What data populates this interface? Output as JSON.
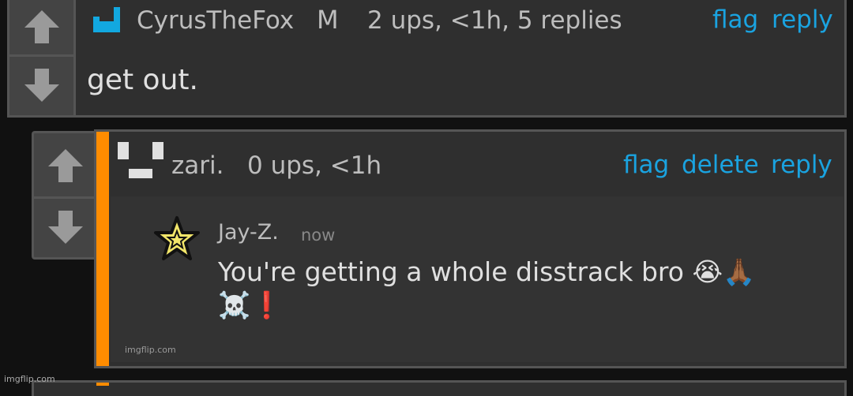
{
  "comment1": {
    "username": "CyrusTheFox",
    "badge": "M",
    "stats": "2 ups, <1h, 5 replies",
    "actions": [
      "flag",
      "reply"
    ],
    "text": "get out.",
    "avatar_color": "#12a8e0"
  },
  "comment2": {
    "username": "zari.",
    "stats": "0 ups, <1h",
    "actions": [
      "flag",
      "delete",
      "reply"
    ],
    "accent_color": "#ff8c00",
    "meme": {
      "name": "Jay-Z.",
      "time": "now",
      "line1": "You're getting a whole disstrack bro 😭🙏🏾",
      "line2": "☠️❗",
      "credit": "imgflip.com"
    }
  },
  "watermark": "imgflip.com",
  "colors": {
    "link": "#1aa3e0",
    "panel": "#2f2f2f",
    "border": "#555555"
  }
}
